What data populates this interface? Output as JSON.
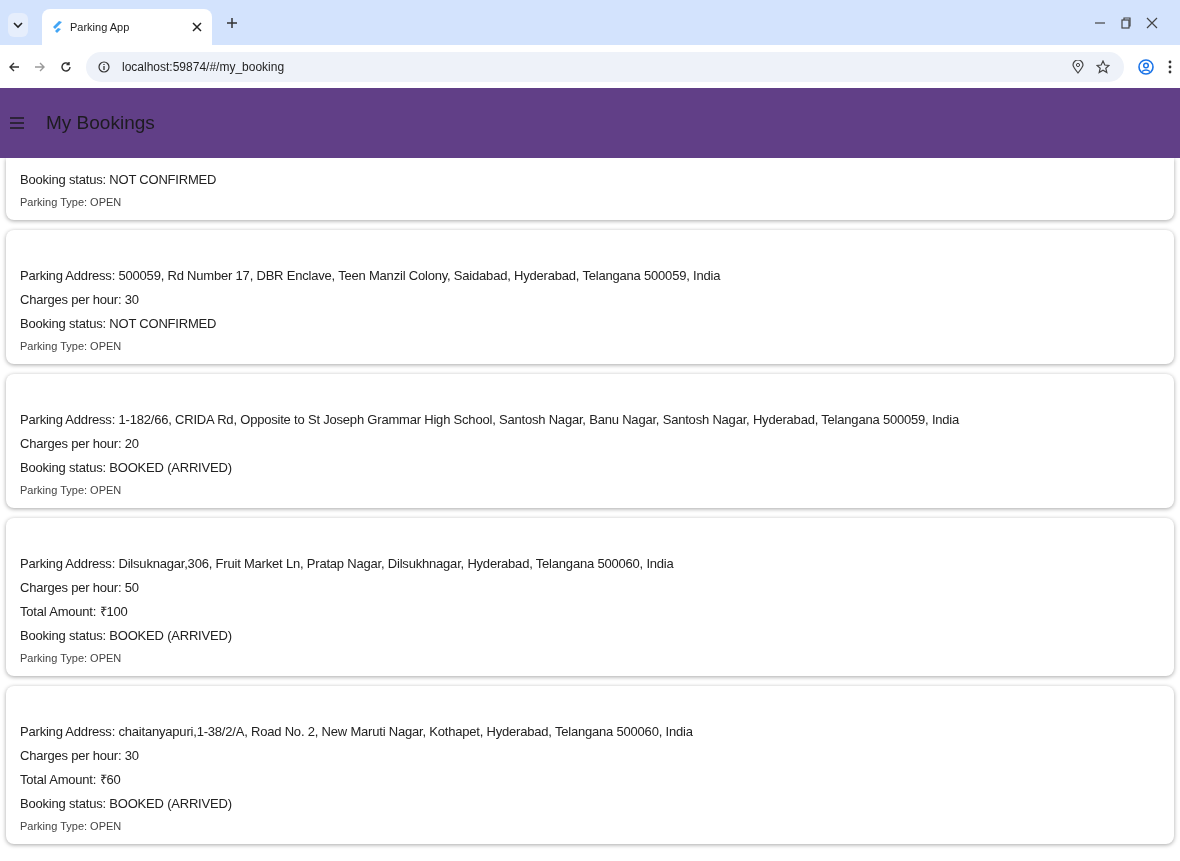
{
  "browser": {
    "tabs": [
      {
        "title": "Parking App",
        "selected": true
      }
    ],
    "url": "localhost:59874/#/my_booking"
  },
  "app_bar": {
    "title": "My Bookings"
  },
  "bookings": [
    {
      "lines": [
        {
          "kind": "main",
          "text": "Booking status: NOT CONFIRMED"
        },
        {
          "kind": "sub",
          "text": "Parking Type: OPEN"
        }
      ]
    },
    {
      "lines": [
        {
          "kind": "main",
          "text": "Parking Address: 500059, Rd Number 17, DBR Enclave, Teen Manzil Colony, Saidabad, Hyderabad, Telangana 500059, India"
        },
        {
          "kind": "main",
          "text": "Charges per hour: 30"
        },
        {
          "kind": "main",
          "text": "Booking status: NOT CONFIRMED"
        },
        {
          "kind": "sub",
          "text": "Parking Type: OPEN"
        }
      ]
    },
    {
      "lines": [
        {
          "kind": "main",
          "text": "Parking Address: 1-182/66, CRIDA Rd, Opposite to St Joseph Grammar High School, Santosh Nagar, Banu Nagar, Santosh Nagar, Hyderabad, Telangana 500059, India"
        },
        {
          "kind": "main",
          "text": "Charges per hour: 20"
        },
        {
          "kind": "main",
          "text": "Booking status: BOOKED (ARRIVED)"
        },
        {
          "kind": "sub",
          "text": "Parking Type: OPEN"
        }
      ]
    },
    {
      "lines": [
        {
          "kind": "main",
          "text": "Parking Address: Dilsuknagar,306, Fruit Market Ln, Pratap Nagar, Dilsukhnagar, Hyderabad, Telangana 500060, India"
        },
        {
          "kind": "main",
          "text": "Charges per hour: 50"
        },
        {
          "kind": "main",
          "text": "Total Amount: ₹100"
        },
        {
          "kind": "main",
          "text": "Booking status: BOOKED (ARRIVED)"
        },
        {
          "kind": "sub",
          "text": "Parking Type: OPEN"
        }
      ]
    },
    {
      "lines": [
        {
          "kind": "main",
          "text": "Parking Address: chaitanyapuri,1-38/2/A, Road No. 2, New Maruti Nagar, Kothapet, Hyderabad, Telangana 500060, India"
        },
        {
          "kind": "main",
          "text": "Charges per hour: 30"
        },
        {
          "kind": "main",
          "text": "Total Amount: ₹60"
        },
        {
          "kind": "main",
          "text": "Booking status: BOOKED (ARRIVED)"
        },
        {
          "kind": "sub",
          "text": "Parking Type: OPEN"
        }
      ]
    }
  ]
}
